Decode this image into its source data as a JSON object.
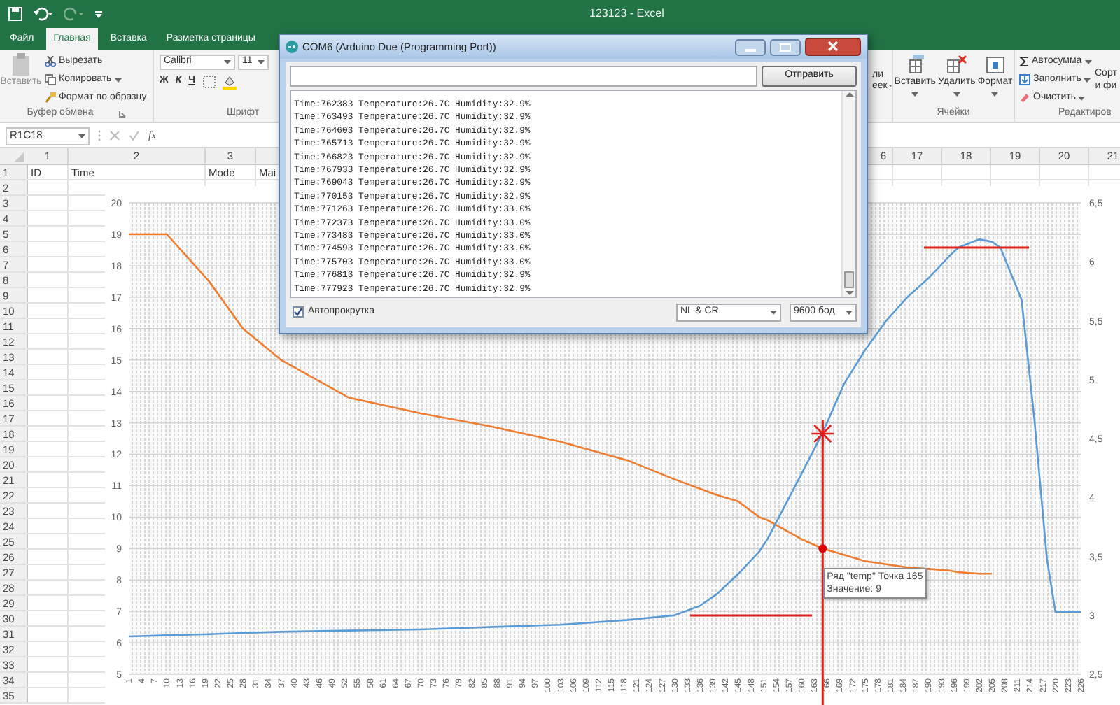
{
  "excel": {
    "title": "123123 - Excel",
    "tabs": [
      {
        "label": "Файл",
        "selected": false
      },
      {
        "label": "Главная",
        "selected": true
      },
      {
        "label": "Вставка",
        "selected": false
      },
      {
        "label": "Разметка страницы",
        "selected": false
      }
    ],
    "ribbon": {
      "clipboard": {
        "paste": "Вставить",
        "cut": "Вырезать",
        "copy": "Копировать",
        "format_painter": "Формат по образцу",
        "label": "Буфер обмена"
      },
      "font": {
        "name": "Calibri",
        "size": "11",
        "bold": "Ж",
        "italic": "К",
        "underline": "Ч",
        "label": "Шрифт"
      },
      "styles": {
        "line_1": "ли",
        "line_2": "еек"
      },
      "cells": {
        "insert": "Вставить",
        "delete": "Удалить",
        "format": "Формат",
        "label": "Ячейки"
      },
      "editing": {
        "autosum": "Автосумма",
        "fill": "Заполнить",
        "clear": "Очистить",
        "sort_1": "Сорт",
        "sort_2": "и фи",
        "label": "Редактиров"
      }
    },
    "name_box": "R1C18",
    "function_label": "fx",
    "columns": [
      "1",
      "2",
      "3",
      "6",
      "17",
      "18",
      "19",
      "20",
      "21"
    ],
    "row_headers": [
      "1",
      "2",
      "3",
      "4",
      "5",
      "6",
      "7",
      "8",
      "9",
      "10",
      "11",
      "12",
      "13",
      "14",
      "15",
      "16",
      "17",
      "18",
      "19",
      "20",
      "21",
      "22",
      "23",
      "24",
      "25",
      "26",
      "27",
      "28",
      "29",
      "30",
      "31",
      "32",
      "33",
      "34",
      "35"
    ],
    "row_1": [
      "ID",
      "Time",
      "Mode",
      "Mai"
    ]
  },
  "chart_data": {
    "type": "line",
    "x": [
      1,
      10,
      20,
      28,
      37,
      53,
      70,
      86,
      103,
      119,
      130,
      136,
      140,
      145,
      150,
      152,
      160,
      165,
      170,
      175,
      180,
      185,
      190,
      195,
      197,
      202,
      205,
      207,
      212,
      215,
      218,
      220,
      226
    ],
    "xticks": [
      1,
      4,
      7,
      10,
      13,
      16,
      19,
      22,
      25,
      28,
      31,
      34,
      37,
      40,
      43,
      46,
      49,
      52,
      55,
      58,
      61,
      64,
      67,
      70,
      73,
      76,
      79,
      82,
      85,
      88,
      91,
      94,
      97,
      100,
      103,
      106,
      109,
      112,
      115,
      118,
      121,
      124,
      127,
      130,
      133,
      136,
      139,
      142,
      145,
      148,
      151,
      154,
      157,
      160,
      163,
      166,
      169,
      172,
      175,
      178,
      181,
      184,
      187,
      190,
      193,
      196,
      199,
      202,
      205,
      208,
      211,
      214,
      217,
      220,
      223,
      226
    ],
    "xlim": [
      1,
      226
    ],
    "ylim": [
      5,
      20
    ],
    "yticks": [
      5,
      6,
      7,
      8,
      9,
      10,
      11,
      12,
      13,
      14,
      15,
      16,
      17,
      18,
      19,
      20
    ],
    "y2lim": [
      2.5,
      6.5
    ],
    "y2ticks": [
      {
        "value": 2.5,
        "label": "2,5"
      },
      {
        "value": 3,
        "label": "3"
      },
      {
        "value": 3.5,
        "label": "3,5"
      },
      {
        "value": 4,
        "label": "4"
      },
      {
        "value": 4.5,
        "label": "4,5"
      },
      {
        "value": 5,
        "label": "5"
      },
      {
        "value": 5.5,
        "label": "5,5"
      },
      {
        "value": 6,
        "label": "6"
      },
      {
        "value": 6.5,
        "label": "6,5"
      }
    ],
    "series": [
      {
        "name": "temp",
        "color": "#ed7d31",
        "values": [
          19,
          19,
          17.5,
          16,
          15,
          13.8,
          13.3,
          12.9,
          12.4,
          11.8,
          11.2,
          10.9,
          10.7,
          10.5,
          10.0,
          9.9,
          9.3,
          9,
          8.8,
          8.6,
          8.5,
          8.4,
          8.35,
          8.3,
          8.25,
          8.2,
          8.2,
          null,
          null,
          null,
          null,
          null,
          null
        ]
      },
      {
        "color": "#5b9bd5",
        "axis": "y2",
        "values": [
          2.82,
          2.83,
          2.84,
          2.85,
          2.86,
          2.87,
          2.88,
          2.9,
          2.92,
          2.96,
          3.0,
          3.08,
          3.18,
          3.35,
          3.54,
          3.65,
          4.2,
          4.55,
          4.96,
          5.25,
          5.5,
          5.7,
          5.86,
          6.05,
          6.12,
          6.19,
          6.17,
          6.12,
          5.68,
          4.67,
          3.48,
          3.03,
          3.03
        ]
      }
    ],
    "grid": true,
    "ref_lines": [
      {
        "axis": "x",
        "value": 165,
        "color": "#e0201a"
      }
    ]
  },
  "chart_tooltip": {
    "prefix": "Ряд \"",
    "suffix": "\" Точка 165",
    "value": "Значение: 9"
  },
  "serial_monitor": {
    "title": "COM6 (Arduino Due (Programming Port))",
    "send_button": "Отправить",
    "lines": [
      "Time:762383 Temperature:26.7C Humidity:32.9%",
      "Time:763493 Temperature:26.7C Humidity:32.9%",
      "Time:764603 Temperature:26.7C Humidity:32.9%",
      "Time:765713 Temperature:26.7C Humidity:32.9%",
      "Time:766823 Temperature:26.7C Humidity:32.9%",
      "Time:767933 Temperature:26.7C Humidity:32.9%",
      "Time:769043 Temperature:26.7C Humidity:32.9%",
      "Time:770153 Temperature:26.7C Humidity:32.9%",
      "Time:771263 Temperature:26.7C Humidity:33.0%",
      "Time:772373 Temperature:26.7C Humidity:33.0%",
      "Time:773483 Temperature:26.7C Humidity:33.0%",
      "Time:774593 Temperature:26.7C Humidity:33.0%",
      "Time:775703 Temperature:26.7C Humidity:33.0%",
      "Time:776813 Temperature:26.7C Humidity:32.9%",
      "Time:777923 Temperature:26.7C Humidity:32.9%"
    ],
    "autoscroll": {
      "label": "Автопрокрутка",
      "checked": true
    },
    "line_ending": "NL & CR",
    "baud": "9600 бод"
  }
}
